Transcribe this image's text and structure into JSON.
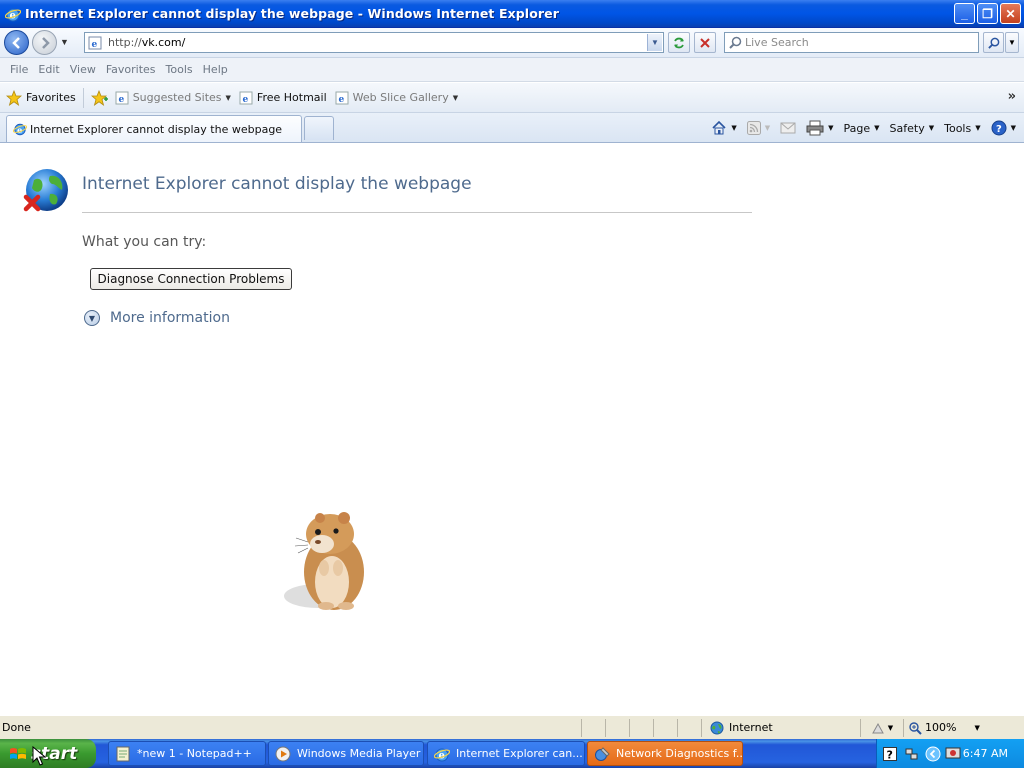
{
  "window": {
    "title": "Internet Explorer cannot display the webpage - Windows Internet Explorer",
    "buttons": {
      "minimize": "_",
      "restore": "❐",
      "close": "✕"
    }
  },
  "address_bar": {
    "url_prefix": "http://",
    "url_host": "vk.com/",
    "search_placeholder": "Live Search"
  },
  "menu": {
    "items": [
      "File",
      "Edit",
      "View",
      "Favorites",
      "Tools",
      "Help"
    ]
  },
  "favorites_bar": {
    "favorites_label": "Favorites",
    "links": [
      {
        "label": "Suggested Sites",
        "has_menu": true
      },
      {
        "label": "Free Hotmail",
        "has_menu": false
      },
      {
        "label": "Web Slice Gallery",
        "has_menu": true
      }
    ],
    "overflow": "»"
  },
  "tabs": {
    "active_tab": "Internet Explorer cannot display the webpage"
  },
  "command_bar": {
    "page": "Page",
    "safety": "Safety",
    "tools": "Tools"
  },
  "content": {
    "heading": "Internet Explorer cannot display the webpage",
    "try_label": "What you can try:",
    "diagnose_button": "Diagnose Connection Problems",
    "more_information": "More information"
  },
  "status_bar": {
    "status": "Done",
    "zone": "Internet",
    "zoom": "100%"
  },
  "taskbar": {
    "start_label": "start",
    "tasks": [
      {
        "label": "*new 1 - Notepad++",
        "icon": "notepad-icon",
        "active": false
      },
      {
        "label": "Windows Media Player",
        "icon": "media-player-icon",
        "active": false
      },
      {
        "label": "Internet Explorer can...",
        "icon": "ie-icon",
        "active": false
      },
      {
        "label": "Network Diagnostics f...",
        "icon": "network-diagnostics-icon",
        "active": true
      }
    ],
    "clock": "6:47 AM"
  },
  "colors": {
    "title_bar": "#0055e6",
    "heading_text": "#4e6a8d",
    "taskbar": "#2663e0",
    "start_button": "#3a9a2f",
    "active_task": "#e56a17"
  }
}
